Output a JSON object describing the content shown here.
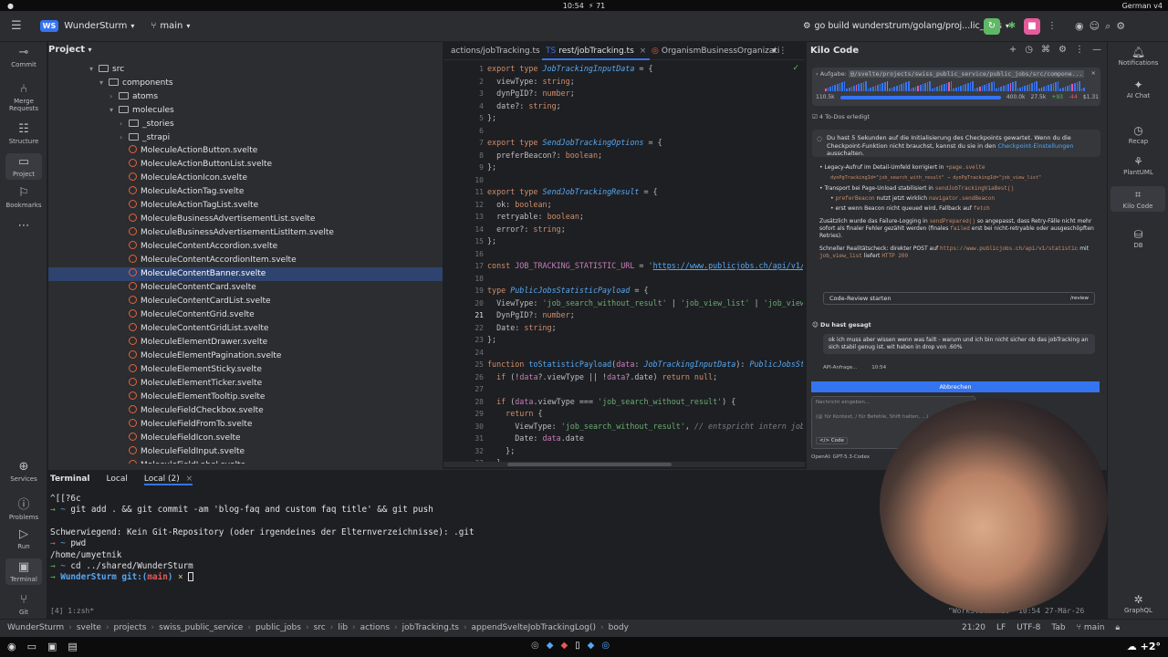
{
  "os": {
    "time": "10:54",
    "bolt": "71",
    "lang": "German v4"
  },
  "title": {
    "project_badge": "WS",
    "project": "WunderSturm",
    "branch": "main",
    "run_config": "go build wunderstrum/golang/proj...lic_jobs"
  },
  "left_tools": [
    {
      "label": "Commit",
      "icon": "commit-icon"
    },
    {
      "label": "Merge Requests",
      "icon": "merge-icon"
    },
    {
      "label": "Structure",
      "icon": "structure-icon"
    },
    {
      "label": "Project",
      "icon": "folder-icon"
    },
    {
      "label": "Bookmarks",
      "icon": "bookmark-icon"
    },
    {
      "label": "Services",
      "icon": "services-icon"
    },
    {
      "label": "Problems",
      "icon": "problems-icon"
    },
    {
      "label": "Run",
      "icon": "run-icon"
    },
    {
      "label": "Terminal",
      "icon": "terminal-icon"
    },
    {
      "label": "Git",
      "icon": "git-icon"
    }
  ],
  "project": {
    "title": "Project",
    "tree": [
      {
        "label": "src",
        "kind": "folder",
        "depth": 0,
        "open": true
      },
      {
        "label": "components",
        "kind": "folder",
        "depth": 1,
        "open": true
      },
      {
        "label": "atoms",
        "kind": "folder",
        "depth": 2,
        "open": false
      },
      {
        "label": "molecules",
        "kind": "folder",
        "depth": 2,
        "open": true
      },
      {
        "label": "_stories",
        "kind": "folder",
        "depth": 3,
        "open": false
      },
      {
        "label": "_strapi",
        "kind": "folder",
        "depth": 3,
        "open": false
      },
      {
        "label": "MoleculeActionButton.svelte",
        "kind": "file",
        "depth": 3
      },
      {
        "label": "MoleculeActionButtonList.svelte",
        "kind": "file",
        "depth": 3
      },
      {
        "label": "MoleculeActionIcon.svelte",
        "kind": "file",
        "depth": 3
      },
      {
        "label": "MoleculeActionTag.svelte",
        "kind": "file",
        "depth": 3
      },
      {
        "label": "MoleculeActionTagList.svelte",
        "kind": "file",
        "depth": 3
      },
      {
        "label": "MoleculeBusinessAdvertisementList.svelte",
        "kind": "file",
        "depth": 3
      },
      {
        "label": "MoleculeBusinessAdvertisementListItem.svelte",
        "kind": "file",
        "depth": 3
      },
      {
        "label": "MoleculeContentAccordion.svelte",
        "kind": "file",
        "depth": 3
      },
      {
        "label": "MoleculeContentAccordionItem.svelte",
        "kind": "file",
        "depth": 3
      },
      {
        "label": "MoleculeContentBanner.svelte",
        "kind": "file",
        "depth": 3,
        "selected": true
      },
      {
        "label": "MoleculeContentCard.svelte",
        "kind": "file",
        "depth": 3
      },
      {
        "label": "MoleculeContentCardList.svelte",
        "kind": "file",
        "depth": 3
      },
      {
        "label": "MoleculeContentGrid.svelte",
        "kind": "file",
        "depth": 3
      },
      {
        "label": "MoleculeContentGridList.svelte",
        "kind": "file",
        "depth": 3
      },
      {
        "label": "MoleculeElementDrawer.svelte",
        "kind": "file",
        "depth": 3
      },
      {
        "label": "MoleculeElementPagination.svelte",
        "kind": "file",
        "depth": 3
      },
      {
        "label": "MoleculeElementSticky.svelte",
        "kind": "file",
        "depth": 3
      },
      {
        "label": "MoleculeElementTicker.svelte",
        "kind": "file",
        "depth": 3
      },
      {
        "label": "MoleculeElementTooltip.svelte",
        "kind": "file",
        "depth": 3
      },
      {
        "label": "MoleculeFieldCheckbox.svelte",
        "kind": "file",
        "depth": 3
      },
      {
        "label": "MoleculeFieldFromTo.svelte",
        "kind": "file",
        "depth": 3
      },
      {
        "label": "MoleculeFieldIcon.svelte",
        "kind": "file",
        "depth": 3
      },
      {
        "label": "MoleculeFieldInput.svelte",
        "kind": "file",
        "depth": 3
      },
      {
        "label": "MoleculeFieldLabel.svelte",
        "kind": "file",
        "depth": 3
      }
    ]
  },
  "editor": {
    "tabs": [
      {
        "label": "actions/jobTracking.ts",
        "active": false
      },
      {
        "label": "rest/jobTracking.ts",
        "active": true
      },
      {
        "label": "OrganismBusinessOrganizati",
        "active": false
      }
    ],
    "lines": [
      {
        "n": "1",
        "html": "<span class='kw'>export type </span><span class='ty'>JobTrackingInputData</span><span class='tx'> = {</span>"
      },
      {
        "n": "2",
        "html": "<span class='tx'>  viewType: </span><span class='kw'>string</span><span class='tx'>;</span>"
      },
      {
        "n": "3",
        "html": "<span class='tx'>  dynPgID?: </span><span class='kw'>number</span><span class='tx'>;</span>"
      },
      {
        "n": "4",
        "html": "<span class='tx'>  date?: </span><span class='kw'>string</span><span class='tx'>;</span>"
      },
      {
        "n": "5",
        "html": "<span class='tx'>};</span>"
      },
      {
        "n": "6",
        "html": ""
      },
      {
        "n": "7",
        "html": "<span class='kw'>export type </span><span class='ty'>SendJobTrackingOptions</span><span class='tx'> = {</span>"
      },
      {
        "n": "8",
        "html": "<span class='tx'>  preferBeacon?: </span><span class='kw'>boolean</span><span class='tx'>;</span>"
      },
      {
        "n": "9",
        "html": "<span class='tx'>};</span>"
      },
      {
        "n": "10",
        "html": ""
      },
      {
        "n": "11",
        "html": "<span class='kw'>export type </span><span class='ty'>SendJobTrackingResult</span><span class='tx'> = {</span>"
      },
      {
        "n": "12",
        "html": "<span class='tx'>  ok: </span><span class='kw'>boolean</span><span class='tx'>;</span>"
      },
      {
        "n": "13",
        "html": "<span class='tx'>  retryable: </span><span class='kw'>boolean</span><span class='tx'>;</span>"
      },
      {
        "n": "14",
        "html": "<span class='tx'>  error?: </span><span class='kw'>string</span><span class='tx'>;</span>"
      },
      {
        "n": "15",
        "html": "<span class='tx'>};</span>"
      },
      {
        "n": "16",
        "html": ""
      },
      {
        "n": "17",
        "html": "<span class='kw'>const </span><span class='pr'>JOB_TRACKING_STATISTIC_URL</span><span class='tx'> = </span><span class='st'>'</span><span class='url'>https://www.publicjobs.ch/api/v1/</span>"
      },
      {
        "n": "18",
        "html": ""
      },
      {
        "n": "19",
        "html": "<span class='kw'>type </span><span class='ty'>PublicJobsStatisticPayload</span><span class='tx'> = {</span>"
      },
      {
        "n": "20",
        "html": "<span class='tx'>  ViewType: </span><span class='st'>'job_search_without_result'</span><span class='tx'> | </span><span class='st'>'job_view_list'</span><span class='tx'> | </span><span class='st'>'job_view</span>"
      },
      {
        "n": "21",
        "html": "<span class='tx'>  DynPgID?: </span><span class='kw'>number</span><span class='tx'>;</span>"
      },
      {
        "n": "22",
        "html": "<span class='tx'>  Date: </span><span class='kw'>string</span><span class='tx'>;</span>"
      },
      {
        "n": "23",
        "html": "<span class='tx'>};</span>"
      },
      {
        "n": "24",
        "html": ""
      },
      {
        "n": "25",
        "html": "<span class='kw'>function </span><span class='fn'>toStatisticPayload</span><span class='tx'>(</span><span class='pr'>data</span><span class='tx'>: </span><span class='ty'>JobTrackingInputData</span><span class='tx'>): </span><span class='ty'>PublicJobsSt</span>"
      },
      {
        "n": "26",
        "html": "<span class='kw'>  if </span><span class='tx'>(!</span><span class='pr'>data</span><span class='tx'>?.viewType || !</span><span class='pr'>data</span><span class='tx'>?.date) </span><span class='kw'>return null</span><span class='tx'>;</span>"
      },
      {
        "n": "27",
        "html": ""
      },
      {
        "n": "28",
        "html": "<span class='kw'>  if </span><span class='tx'>(</span><span class='pr'>data</span><span class='tx'>.viewType === </span><span class='st'>'job_search_without_result'</span><span class='tx'>) {</span>"
      },
      {
        "n": "29",
        "html": "<span class='kw'>    return </span><span class='tx'>{</span>"
      },
      {
        "n": "30",
        "html": "<span class='tx'>      ViewType: </span><span class='st'>'job_search_without_result'</span><span class='tx'>, </span><span class='cm'>// entspricht intern job</span>"
      },
      {
        "n": "31",
        "html": "<span class='tx'>      Date: </span><span class='pr'>data</span><span class='tx'>.date</span>"
      },
      {
        "n": "32",
        "html": "<span class='tx'>    };</span>"
      },
      {
        "n": "33",
        "html": "<span class='tx'>  }</span>"
      }
    ]
  },
  "kilo": {
    "title": "Kilo Code",
    "task_label": "Aufgabe:",
    "task_path": "@/svelte/projects/swiss_public_service/public_jobs/src/compone...",
    "stats_left": "110.5k",
    "stats_mid": "400.0k",
    "stats_tokens_up": "27.5k",
    "stats_up": "+93",
    "stats_down": "-44",
    "stats_cost": "$1.31",
    "todos": "4 To-Dos erledigt",
    "checkpoint_msg": "Du hast 5 Sekunden auf die Initialisierung des Checkpoints gewartet. Wenn du die Checkpoint-Funktion nicht brauchst, kannst du sie in den",
    "checkpoint_link": "Checkpoint-Einstellungen",
    "checkpoint_tail": "ausschalten.",
    "bullet1": "Legacy-Aufruf im Detail-Umfeld korrigiert in",
    "bullet1_code": "+page.svelte",
    "bullet1_sub": "dynPgTrackingId=\"job_search_with_result\" → dynPgTrackingId=\"job_view_list\"",
    "bullet2": "Transport bei Page-Unload stabilisiert in",
    "bullet2_code": "sendJobTrackingViaBest()",
    "bullet2_sub1_code": "preferBeacon",
    "bullet2_sub1": "nutzt jetzt wirklich",
    "bullet2_sub1_code2": "navigator.sendBeacon",
    "bullet2_sub2": "erst wenn Beacon nicht queued wird, Fallback auf",
    "bullet2_sub2_code": "fetch",
    "para1": "Zusätzlich wurde das Failure-Logging in",
    "para1_code": "sendPrepared()",
    "para1_tail": "so angepasst, dass Retry-Fälle nicht mehr sofort als finaler Fehler gezählt werden (finales",
    "para1_code2": "failed",
    "para1_tail2": "erst bei nicht-retryable oder ausgeschöpften Retries).",
    "para2": "Schneller Realitätscheck: direkter POST auf",
    "para2_code": "https://www.publicjobs.ch/api/v1/statistic",
    "para2_tail": "mit",
    "para2_code2": "job_view_list",
    "para2_tail2": "liefert",
    "para2_code3": "HTTP 200",
    "review_label": "Code-Review starten",
    "review_cmd": "/review",
    "you_said": "Du hast gesagt",
    "user_msg": "ok ich muss aber wissen wenn was failt - warum und ich bin nicht sicher ob das jobTracking an sich stabil genug ist. wit haben in drop von .60%",
    "api_label": "API-Anfrage...",
    "api_time": "10:54",
    "cancel": "Abbrechen",
    "input_placeholder": "Nachricht eingeben...",
    "input_hint": "(@ für Kontext, / für Befehle, Shift halten, ...)",
    "mode": "Code",
    "model": "OpenAI: GPT-5.3-Codex"
  },
  "right_tools": [
    {
      "label": "Notifications",
      "icon": "bell-icon"
    },
    {
      "label": "AI Chat",
      "icon": "ai-chat-icon"
    },
    {
      "label": "Recap",
      "icon": "recap-icon"
    },
    {
      "label": "PlantUML",
      "icon": "plantuml-icon"
    },
    {
      "label": "Kilo Code",
      "icon": "kilo-icon"
    },
    {
      "label": "DB",
      "icon": "database-icon"
    },
    {
      "label": "GraphQL",
      "icon": "graphql-icon"
    }
  ],
  "terminal": {
    "tab_title": "Terminal",
    "tabs": [
      "Local",
      "Local (2)"
    ],
    "lines": [
      "^[[?6c",
      "→ ~ git add . && git commit -am 'blog-faq and custom faq title' && git push",
      "",
      "Schwerwiegend: Kein Git-Repository (oder irgendeines der Elternverzeichnisse): .git",
      "→ ~ pwd",
      "/home/umyetnik",
      "→ ~ cd ../shared/WunderSturm",
      "→ WunderSturm git:(main) ×"
    ],
    "session": "[4] 1:zsh*",
    "watermark": "\"WorkStation10\" 10:54 27-Mär-26"
  },
  "status": {
    "breadcrumbs": [
      "WunderSturm",
      "svelte",
      "projects",
      "swiss_public_service",
      "public_jobs",
      "src",
      "lib",
      "actions",
      "jobTracking.ts",
      "appendSvelteJobTrackingLog()",
      "body"
    ],
    "pos": "21:20",
    "eol": "LF",
    "enc": "UTF-8",
    "indent": "Tab",
    "branch": "main"
  },
  "taskbar": {
    "temp": "+2°"
  },
  "colors": {
    "accent": "#3574f0",
    "run_green": "#5fb865",
    "stop_pink": "#e55b9c",
    "selection": "#2e436e"
  }
}
